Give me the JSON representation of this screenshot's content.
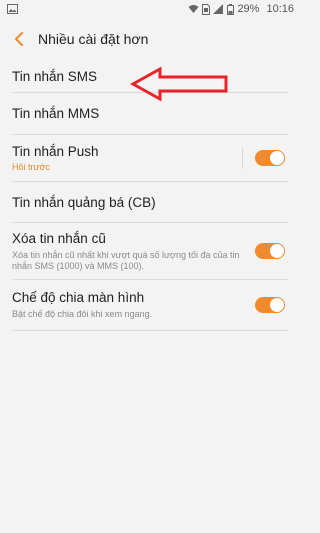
{
  "status_bar": {
    "battery": "29%",
    "time": "10:16",
    "icons": [
      "image-icon",
      "wifi-icon",
      "sim-icon",
      "signal-icon",
      "battery-icon"
    ]
  },
  "app_bar": {
    "back_icon": "chevron-left-icon",
    "title": "Nhiều cài đặt hơn"
  },
  "items": [
    {
      "title": "Tin nhắn SMS"
    },
    {
      "title": "Tin nhắn MMS"
    },
    {
      "title": "Tin nhắn Push",
      "subtitle": "Hỏi trước",
      "toggle_on": true
    },
    {
      "title": "Tin nhắn quảng bá (CB)"
    },
    {
      "title": "Xóa tin nhắn cũ",
      "subtitle": "Xóa tin nhắn cũ nhất khi vượt quá số lượng tối đa của tin nhắn SMS (1000) và MMS (100).",
      "toggle_on": true
    },
    {
      "title": "Chế độ chia màn hình",
      "subtitle": "Bật chế độ chia đôi khi xem ngang.",
      "toggle_on": true
    }
  ],
  "colors": {
    "accent": "#ef8a2f",
    "annotation": "#e8232a",
    "background": "#f3f3f3"
  },
  "annotation": {
    "shape": "arrow-left",
    "points_to": "Tin nhắn SMS"
  }
}
